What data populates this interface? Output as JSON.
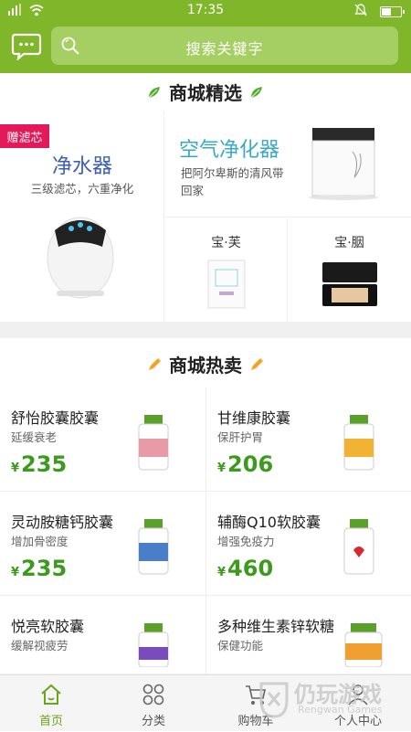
{
  "status_bar": {
    "time": "17:35",
    "battery_level": 0.55
  },
  "search": {
    "placeholder": "搜索关键字"
  },
  "featured_section": {
    "title": "商城精选",
    "water_purifier": {
      "badge": "赠滤芯",
      "title": "净水器",
      "subtitle": "三级滤芯，六重净化"
    },
    "air_purifier": {
      "title": "空气净化器",
      "subtitle": "把阿尔卑斯的清风带回家"
    },
    "baofu": {
      "title": "宝·芙"
    },
    "baodan": {
      "title": "宝·胭"
    }
  },
  "hot_section": {
    "title": "商城热卖",
    "currency": "¥",
    "products": [
      {
        "name": "舒怡胶囊胶囊",
        "desc": "延缓衰老",
        "price": "235"
      },
      {
        "name": "甘维康胶囊",
        "desc": "保肝护胃",
        "price": "206"
      },
      {
        "name": "灵动胺糖钙胶囊",
        "desc": "增加骨密度",
        "price": "235"
      },
      {
        "name": "辅酶Q10软胶囊",
        "desc": "增强免疫力",
        "price": "460"
      },
      {
        "name": "悦亮软胶囊",
        "desc": "缓解视疲劳",
        "price": ""
      },
      {
        "name": "多种维生素锌软糖",
        "desc": "保健功能",
        "price": ""
      }
    ]
  },
  "tabbar": [
    {
      "label": "首页",
      "icon": "home-icon",
      "active": true
    },
    {
      "label": "分类",
      "icon": "grid-icon",
      "active": false
    },
    {
      "label": "购物车",
      "icon": "cart-icon",
      "active": false
    },
    {
      "label": "个人中心",
      "icon": "user-icon",
      "active": false
    }
  ],
  "watermark": {
    "text": "仍玩游戏",
    "sub": "Rengwan Games"
  },
  "colors": {
    "brand_green": "#7fb62a",
    "price_green": "#3c9a1c",
    "badge_red": "#e4195b",
    "active_tab": "#6aa51c"
  }
}
